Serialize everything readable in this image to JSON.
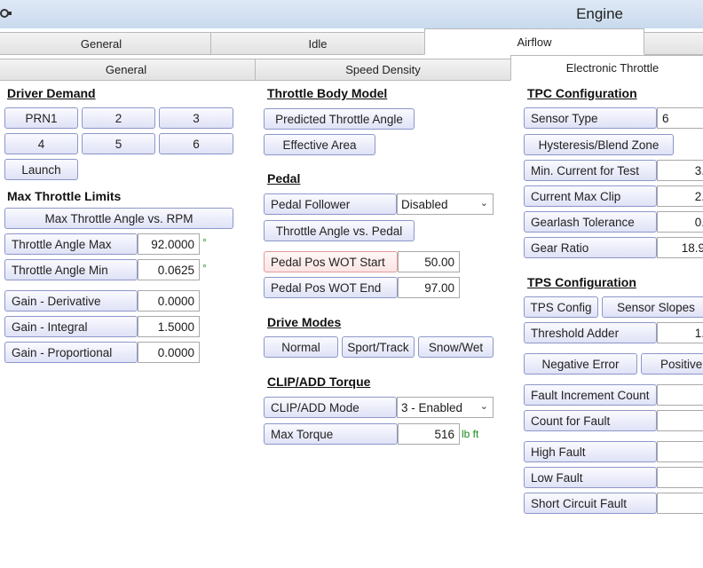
{
  "window": {
    "title": "Engine"
  },
  "tabs_top": [
    "General",
    "Idle",
    "Airflow"
  ],
  "tabs_sub": [
    "General",
    "Speed Density",
    "Electronic Throttle"
  ],
  "driver_demand": {
    "heading": "Driver Demand",
    "buttons": [
      "PRN1",
      "2",
      "3",
      "4",
      "5",
      "6",
      "Launch"
    ]
  },
  "max_throttle": {
    "heading": "Max Throttle Limits",
    "table_button": "Max Throttle Angle vs. RPM",
    "rows": [
      {
        "label": "Throttle Angle Max",
        "value": "92.0000",
        "unit": "°"
      },
      {
        "label": "Throttle Angle Min",
        "value": "0.0625",
        "unit": "°"
      }
    ],
    "gains": [
      {
        "label": "Gain - Derivative",
        "value": "0.0000"
      },
      {
        "label": "Gain - Integral",
        "value": "1.5000"
      },
      {
        "label": "Gain - Proportional",
        "value": "0.0000"
      }
    ]
  },
  "throttle_body": {
    "heading": "Throttle Body Model",
    "buttons": [
      "Predicted Throttle Angle",
      "Effective Area"
    ]
  },
  "pedal": {
    "heading": "Pedal",
    "follower_label": "Pedal Follower",
    "follower_value": "Disabled",
    "table_button": "Throttle Angle vs. Pedal",
    "wot_start_label": "Pedal Pos WOT Start",
    "wot_start_value": "50.00",
    "wot_end_label": "Pedal Pos WOT End",
    "wot_end_value": "97.00"
  },
  "drive_modes": {
    "heading": "Drive Modes",
    "buttons": [
      "Normal",
      "Sport/Track",
      "Snow/Wet"
    ]
  },
  "clip_add": {
    "heading": "CLIP/ADD Torque",
    "mode_label": "CLIP/ADD Mode",
    "mode_value": "3 - Enabled",
    "max_torque_label": "Max Torque",
    "max_torque_value": "516",
    "max_torque_unit": "lb ft"
  },
  "tpc": {
    "heading": "TPC Configuration",
    "sensor_type_label": "Sensor Type",
    "sensor_type_value": "6",
    "hysteresis_button": "Hysteresis/Blend Zone",
    "rows": [
      {
        "label": "Min. Current for Test",
        "value": "3."
      },
      {
        "label": "Current Max Clip",
        "value": "2."
      },
      {
        "label": "Gearlash Tolerance",
        "value": "0."
      },
      {
        "label": "Gear Ratio",
        "value": "18.9"
      }
    ]
  },
  "tps": {
    "heading": "TPS Configuration",
    "buttons": [
      "TPS Config",
      "Sensor Slopes"
    ],
    "threshold_label": "Threshold Adder",
    "threshold_value": "1.",
    "error_buttons": [
      "Negative Error",
      "Positive"
    ],
    "fault_rows": [
      "Fault Increment Count",
      "Count for Fault"
    ],
    "fault_rows2": [
      "High Fault",
      "Low Fault",
      "Short Circuit Fault"
    ]
  }
}
